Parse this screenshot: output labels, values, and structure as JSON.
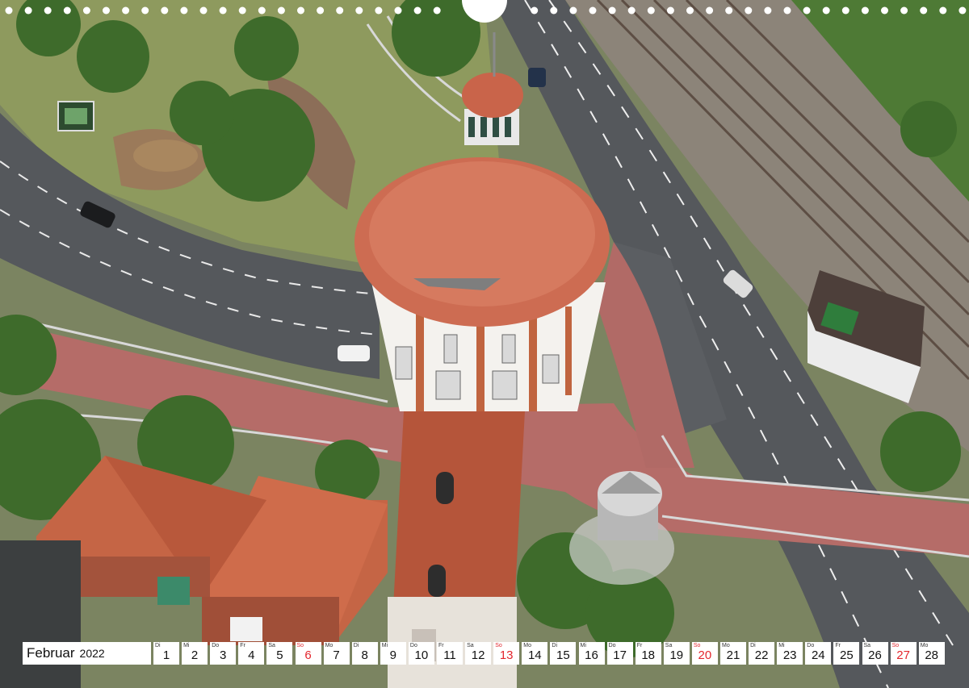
{
  "calendar": {
    "month": "Februar",
    "year": "2022",
    "days": [
      {
        "abbr": "Di",
        "num": "1",
        "sunday": false
      },
      {
        "abbr": "Mi",
        "num": "2",
        "sunday": false
      },
      {
        "abbr": "Do",
        "num": "3",
        "sunday": false
      },
      {
        "abbr": "Fr",
        "num": "4",
        "sunday": false
      },
      {
        "abbr": "Sa",
        "num": "5",
        "sunday": false
      },
      {
        "abbr": "So",
        "num": "6",
        "sunday": true
      },
      {
        "abbr": "Mo",
        "num": "7",
        "sunday": false
      },
      {
        "abbr": "Di",
        "num": "8",
        "sunday": false
      },
      {
        "abbr": "Mi",
        "num": "9",
        "sunday": false
      },
      {
        "abbr": "Do",
        "num": "10",
        "sunday": false
      },
      {
        "abbr": "Fr",
        "num": "11",
        "sunday": false
      },
      {
        "abbr": "Sa",
        "num": "12",
        "sunday": false
      },
      {
        "abbr": "So",
        "num": "13",
        "sunday": true
      },
      {
        "abbr": "Mo",
        "num": "14",
        "sunday": false
      },
      {
        "abbr": "Di",
        "num": "15",
        "sunday": false
      },
      {
        "abbr": "Mi",
        "num": "16",
        "sunday": false
      },
      {
        "abbr": "Do",
        "num": "17",
        "sunday": false
      },
      {
        "abbr": "Fr",
        "num": "18",
        "sunday": false
      },
      {
        "abbr": "Sa",
        "num": "19",
        "sunday": false
      },
      {
        "abbr": "So",
        "num": "20",
        "sunday": true
      },
      {
        "abbr": "Mo",
        "num": "21",
        "sunday": false
      },
      {
        "abbr": "Di",
        "num": "22",
        "sunday": false
      },
      {
        "abbr": "Mi",
        "num": "23",
        "sunday": false
      },
      {
        "abbr": "Do",
        "num": "24",
        "sunday": false
      },
      {
        "abbr": "Fr",
        "num": "25",
        "sunday": false
      },
      {
        "abbr": "Sa",
        "num": "26",
        "sunday": false
      },
      {
        "abbr": "So",
        "num": "27",
        "sunday": true
      },
      {
        "abbr": "Mo",
        "num": "28",
        "sunday": false
      }
    ]
  },
  "colors": {
    "sunday": "#e3262d",
    "roof": "#c8634a",
    "brick": "#b5553a",
    "road": "#55585c",
    "bike_path": "#b36a66",
    "grass": "#8c9a5a",
    "trees": "#3f6b2c"
  }
}
